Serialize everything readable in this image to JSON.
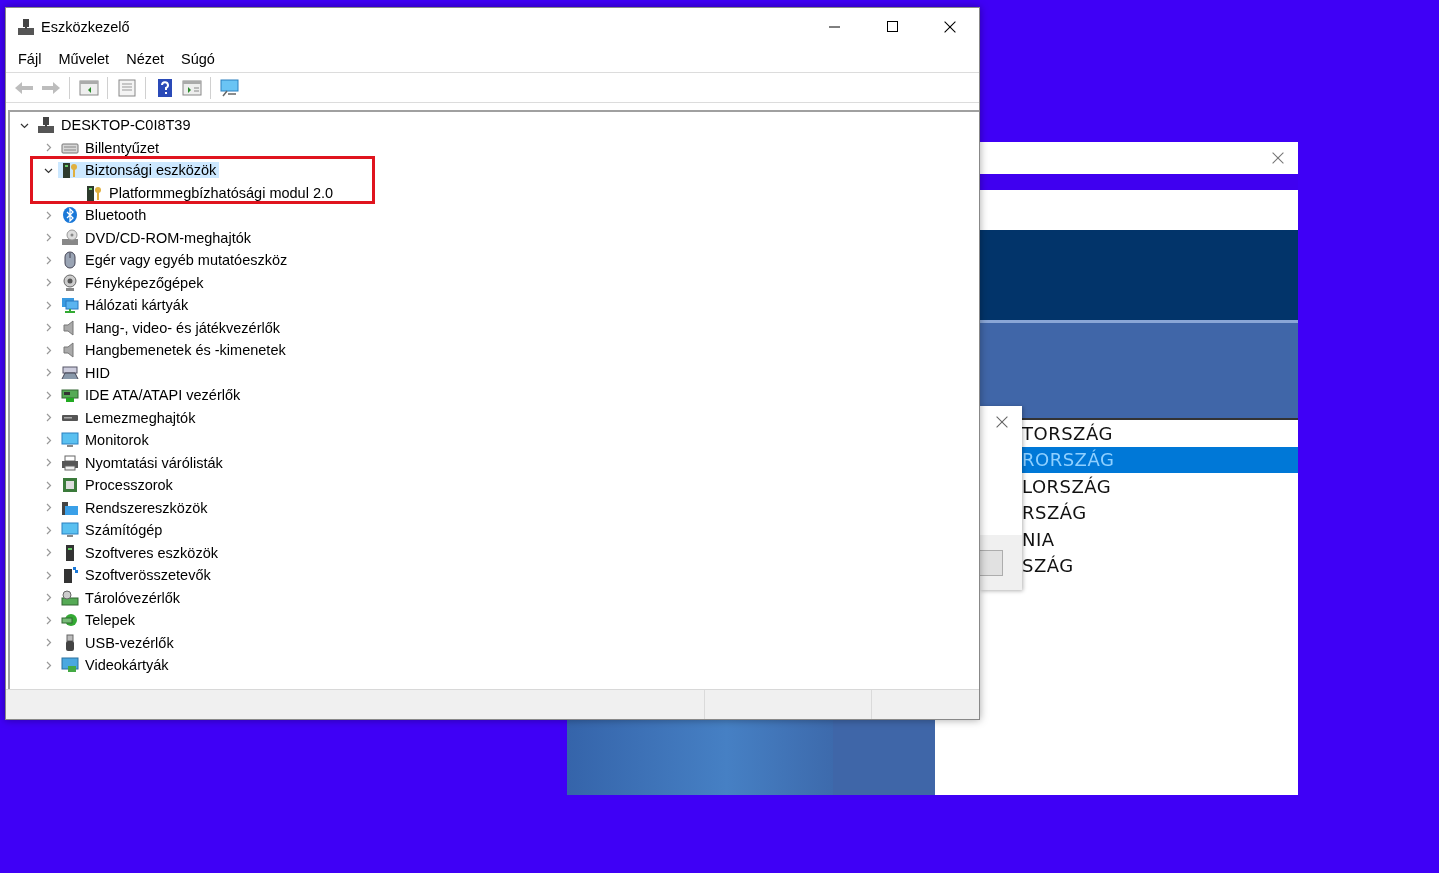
{
  "window": {
    "title": "Eszközkezelő"
  },
  "menu": [
    "Fájl",
    "Művelet",
    "Nézet",
    "Súgó"
  ],
  "toolbar": [
    {
      "disabled": true
    },
    {
      "disabled": true
    },
    {
      "disabled": false
    },
    {
      "disabled": false
    },
    {
      "disabled": false
    },
    {
      "disabled": false
    },
    {
      "disabled": false
    }
  ],
  "tree": {
    "label": "DESKTOP-C0I8T39",
    "expanded": true,
    "selected": false,
    "children": [
      {
        "label": "Billentyűzet",
        "expanded": false,
        "selected": false
      },
      {
        "label": "Biztonsági eszközök",
        "expanded": true,
        "selected": true,
        "children": [
          {
            "label": "Platformmegbízhatósági modul 2.0",
            "selected": false
          }
        ]
      },
      {
        "label": "Bluetooth",
        "expanded": false,
        "selected": false
      },
      {
        "label": "DVD/CD-ROM-meghajtók",
        "expanded": false,
        "selected": false
      },
      {
        "label": "Egér vagy egyéb mutatóeszköz",
        "expanded": false,
        "selected": false
      },
      {
        "label": "Fényképezőgépek",
        "expanded": false,
        "selected": false
      },
      {
        "label": "Hálózati kártyák",
        "expanded": false,
        "selected": false
      },
      {
        "label": "Hang-, video- és játékvezérlők",
        "expanded": false,
        "selected": false
      },
      {
        "label": "Hangbemenetek és -kimenetek",
        "expanded": false,
        "selected": false
      },
      {
        "label": "HID",
        "expanded": false,
        "selected": false
      },
      {
        "label": "IDE ATA/ATAPI vezérlők",
        "expanded": false,
        "selected": false
      },
      {
        "label": "Lemezmeghajtók",
        "expanded": false,
        "selected": false
      },
      {
        "label": "Monitorok",
        "expanded": false,
        "selected": false
      },
      {
        "label": "Nyomtatási várólisták",
        "expanded": false,
        "selected": false
      },
      {
        "label": "Processzorok",
        "expanded": false,
        "selected": false
      },
      {
        "label": "Rendszereszközök",
        "expanded": false,
        "selected": false
      },
      {
        "label": "Számítógép",
        "expanded": false,
        "selected": false
      },
      {
        "label": "Szoftveres eszközök",
        "expanded": false,
        "selected": false
      },
      {
        "label": "Szoftverösszetevők",
        "expanded": false,
        "selected": false
      },
      {
        "label": "Tárolóvezérlők",
        "expanded": false,
        "selected": false
      },
      {
        "label": "Telepek",
        "expanded": false,
        "selected": false
      },
      {
        "label": "USB-vezérlők",
        "expanded": false,
        "selected": false
      },
      {
        "label": "Videokártyák",
        "expanded": false,
        "selected": false
      }
    ]
  },
  "background_window": {
    "list": [
      {
        "text": "TORSZÁG",
        "selected": false
      },
      {
        "text": "RORSZÁG",
        "selected": true
      },
      {
        "text": "LORSZÁG",
        "selected": false
      },
      {
        "text": "RSZÁG",
        "selected": false
      },
      {
        "text": "NIA",
        "selected": false
      },
      {
        "text": "SZÁG",
        "selected": false
      }
    ]
  }
}
